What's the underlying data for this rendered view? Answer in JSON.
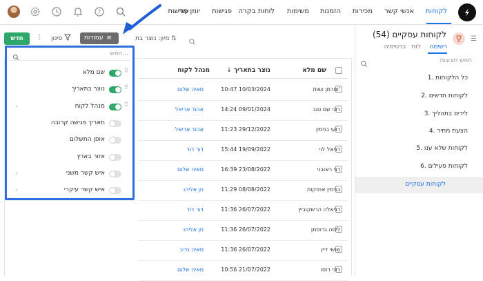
{
  "colors": {
    "accent": "#1a73e8",
    "new_button": "#2ea86a",
    "columns_button": "#6b6b6b",
    "panel_border": "#2f6fe0",
    "toggle_on": "#2ea86a",
    "arrow": "#1f5ed6"
  },
  "topbar": {
    "nav": [
      "לקוחות",
      "אנשי קשר",
      "מכירות",
      "הזמנות",
      "משימות",
      "לוחות בקרה",
      "פגישות",
      "יומן פגישות"
    ],
    "more_label": "עוד",
    "icons": [
      "logo-icon",
      "search-icon",
      "help-icon",
      "bell-icon",
      "history-icon",
      "settings-icon",
      "avatar"
    ]
  },
  "sidebar": {
    "search_placeholder": "חפש תצוגות",
    "items": [
      "1. כל הלקוחות",
      "2. לקוחות חדשים",
      "3. לידים בתהליך",
      "4. הצעת מחיר",
      "5. לקוחות שלא ענו",
      "6. לקוחות פעילים",
      "לקוחות עסקיים"
    ],
    "active_index": 6
  },
  "header": {
    "title": "לקוחות עסקיים (54)",
    "view_tabs": [
      "רשימה",
      "לוח",
      "כרטיסיה"
    ],
    "active_view": 0
  },
  "toolbar": {
    "new_label": "חדש",
    "columns_label": "עמודות",
    "filter_label": "סינון",
    "sort_label": "מיון: נוצר בת"
  },
  "columns_panel": {
    "search_placeholder": "חפש...",
    "items": [
      {
        "label": "שם מלא",
        "on": true
      },
      {
        "label": "נוצר בתאריך",
        "on": true
      },
      {
        "label": "מנהל לקוח",
        "on": true
      },
      {
        "label": "תאריך פגישה קרובה",
        "on": false
      },
      {
        "label": "אופן התשלום",
        "on": false
      },
      {
        "label": "אזור בארץ",
        "on": false
      },
      {
        "label": "איש קשר משני",
        "on": false
      },
      {
        "label": "איש קשר עיקרי",
        "on": false
      }
    ]
  },
  "table": {
    "headers": {
      "name": "שם מלא",
      "created": "נוצר בתאריך",
      "manager": "מנהל לקוח"
    },
    "rows": [
      {
        "name": "וסרמן ושות'",
        "created": "10:47 10/03/2024",
        "manager": "מאיה שלום"
      },
      {
        "name": "רוני שם טוב",
        "created": "14:24 09/01/2024",
        "manager": "אהוד אריאל"
      },
      {
        "name": "רועי בנימין",
        "created": "11:23 29/12/2022",
        "manager": "אהוד אריאל"
      },
      {
        "name": "דניאל לוי",
        "created": "15:44 19/09/2022",
        "manager": "דור דוד"
      },
      {
        "name": "דני ראובני",
        "created": "16:39 23/08/2022",
        "manager": "מאיה שלום"
      },
      {
        "name": "בנימין אחזקות",
        "created": "11:29 08/08/2022",
        "manager": "חן אליהו"
      },
      {
        "name": "דניאלה הרשקוביץ",
        "created": "11:36 26/07/2022",
        "manager": "דור דוד"
      },
      {
        "name": "ליסה גרוסמן",
        "created": "11:36 26/07/2022",
        "manager": "חן אליהו"
      },
      {
        "name": "שושי דיין",
        "created": "11:36 26/07/2022",
        "manager": "מאיה נדיב"
      },
      {
        "name": "רוני רוסו",
        "created": "10:56 21/07/2022",
        "manager": "מאיה שלום"
      }
    ]
  }
}
